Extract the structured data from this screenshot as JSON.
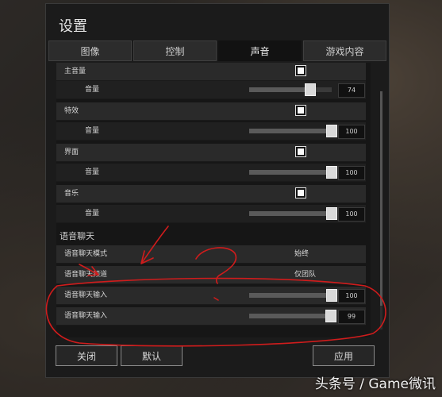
{
  "dialog": {
    "title": "设置"
  },
  "tabs": [
    {
      "label": "图像"
    },
    {
      "label": "控制"
    },
    {
      "label": "声音"
    },
    {
      "label": "游戏内容"
    }
  ],
  "active_tab": 2,
  "groups": [
    {
      "label": "主音量",
      "volume_label": "音量",
      "volume": 74
    },
    {
      "label": "特效",
      "volume_label": "音量",
      "volume": 100
    },
    {
      "label": "界面",
      "volume_label": "音量",
      "volume": 100
    },
    {
      "label": "音乐",
      "volume_label": "音量",
      "volume": 100
    }
  ],
  "voice_chat": {
    "section_title": "语音聊天",
    "mode_label": "语音聊天模式",
    "mode_value": "始终",
    "channel_label": "语音聊天频道",
    "channel_value": "仅团队",
    "inputs": [
      {
        "label": "语音聊天输入",
        "value": 100
      },
      {
        "label": "语音聊天输入",
        "value": 99
      }
    ]
  },
  "buttons": {
    "close": "关闭",
    "default": "默认",
    "apply": "应用"
  },
  "watermark": "头条号 / Game微讯",
  "annotation_color": "#d01c1c"
}
